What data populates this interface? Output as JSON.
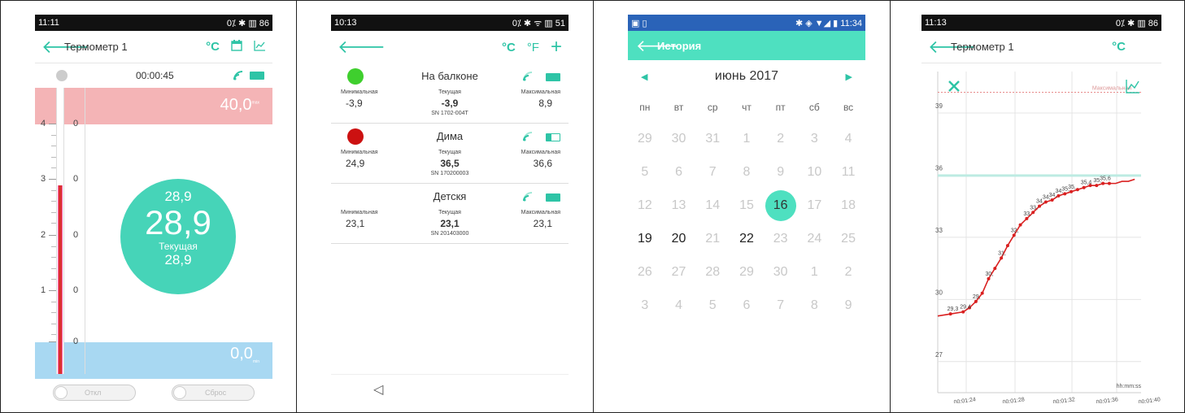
{
  "colors": {
    "accent": "#2ec4a6",
    "hot": "#f4b4b6",
    "cold": "#a8d8f2",
    "mercury": "#d9322e"
  },
  "s1": {
    "status_time": "11:11",
    "status_right": "0⁒ ✱ ▥ 86",
    "title": "Термометр 1",
    "c_icon": "°C",
    "elapsed": "00:00:45",
    "top_value": "40,0",
    "top_unit": "max",
    "bottom_value": "0,0",
    "bottom_unit": "min",
    "scale": [
      {
        "big": "4",
        "small": "0"
      },
      {
        "big": "3",
        "small": "0"
      },
      {
        "big": "2",
        "small": "0"
      },
      {
        "big": "1",
        "small": "0"
      },
      {
        "big": "",
        "small": "0"
      }
    ],
    "circle_top": "28,9",
    "circle_main": "28,9",
    "circle_label": "Текущая",
    "circle_bottom": "28,9",
    "btn_left": "Откл",
    "btn_right": "Сброс"
  },
  "s2": {
    "status_time": "10:13",
    "status_right": "0⁒ ✱ ᯤ ▥ 51",
    "c_label": "°C",
    "f_label": "°F",
    "cards": [
      {
        "name": "На балконе",
        "dot": "#3fcf2e",
        "min_label": "Минимальная",
        "cur_label": "Текущая",
        "max_label": "Максимальная",
        "min": "-3,9",
        "cur": "-3,9",
        "max": "8,9",
        "sn": "SN 1702-004T",
        "battery": 1.0
      },
      {
        "name": "Дима",
        "dot": "#cc1111",
        "min_label": "Минимальная",
        "cur_label": "Текущая",
        "max_label": "Максимальная",
        "min": "24,9",
        "cur": "36,5",
        "max": "36,6",
        "sn": "SN 170200003",
        "battery": 0.35
      },
      {
        "name": "Детскя",
        "dot": "",
        "min_label": "Минимальная",
        "cur_label": "Текущая",
        "max_label": "Максимальная",
        "min": "23,1",
        "cur": "23,1",
        "max": "23,1",
        "sn": "SN 201403000",
        "battery": 1.0
      }
    ]
  },
  "s3": {
    "status_time": "11:34",
    "title": "История",
    "month": "июнь 2017",
    "weekdays": [
      "пн",
      "вт",
      "ср",
      "чт",
      "пт",
      "сб",
      "вс"
    ],
    "weeks": [
      [
        {
          "d": "29",
          "s": "o"
        },
        {
          "d": "30",
          "s": "o"
        },
        {
          "d": "31",
          "s": "o"
        },
        {
          "d": "1",
          "s": "o"
        },
        {
          "d": "2",
          "s": "o"
        },
        {
          "d": "3",
          "s": "o"
        },
        {
          "d": "4",
          "s": "o"
        }
      ],
      [
        {
          "d": "5",
          "s": "o"
        },
        {
          "d": "6",
          "s": "o"
        },
        {
          "d": "7",
          "s": "o"
        },
        {
          "d": "8",
          "s": "o"
        },
        {
          "d": "9",
          "s": "o"
        },
        {
          "d": "10",
          "s": "o"
        },
        {
          "d": "11",
          "s": "o"
        }
      ],
      [
        {
          "d": "12",
          "s": "o"
        },
        {
          "d": "13",
          "s": "o"
        },
        {
          "d": "14",
          "s": "o"
        },
        {
          "d": "15",
          "s": "o"
        },
        {
          "d": "16",
          "s": "sel"
        },
        {
          "d": "17",
          "s": "o"
        },
        {
          "d": "18",
          "s": "o"
        }
      ],
      [
        {
          "d": "19",
          "s": "a"
        },
        {
          "d": "20",
          "s": "a"
        },
        {
          "d": "21",
          "s": "o"
        },
        {
          "d": "22",
          "s": "a"
        },
        {
          "d": "23",
          "s": "o"
        },
        {
          "d": "24",
          "s": "o"
        },
        {
          "d": "25",
          "s": "o"
        }
      ],
      [
        {
          "d": "26",
          "s": "o"
        },
        {
          "d": "27",
          "s": "o"
        },
        {
          "d": "28",
          "s": "o"
        },
        {
          "d": "29",
          "s": "o"
        },
        {
          "d": "30",
          "s": "o"
        },
        {
          "d": "1",
          "s": "o"
        },
        {
          "d": "2",
          "s": "o"
        }
      ],
      [
        {
          "d": "3",
          "s": "o"
        },
        {
          "d": "4",
          "s": "o"
        },
        {
          "d": "5",
          "s": "o"
        },
        {
          "d": "6",
          "s": "o"
        },
        {
          "d": "7",
          "s": "o"
        },
        {
          "d": "8",
          "s": "o"
        },
        {
          "d": "9",
          "s": "o"
        }
      ]
    ]
  },
  "s4": {
    "status_time": "11:13",
    "status_right": "0⁒ ✱ ▥ 86",
    "title": "Термометр 1",
    "c_icon": "°C",
    "chart_data": {
      "type": "line",
      "xlabel": "hh:mm:ss",
      "x_ticks": [
        "00:01:24",
        "00:01:28",
        "00:01:32",
        "00:01:36",
        "00:01:40"
      ],
      "y_ticks": [
        27,
        30,
        33,
        36,
        39
      ],
      "ylim": [
        25.5,
        41
      ],
      "max_line": {
        "label": "Максимальная",
        "value": 40.0
      },
      "current_line": 36.0,
      "series": [
        {
          "x": [
            0,
            2,
            4,
            5,
            6,
            7,
            8,
            9,
            10,
            11,
            12,
            13,
            14,
            15,
            16,
            17,
            18,
            19,
            20,
            21,
            22,
            23,
            24,
            25,
            26,
            27,
            28,
            29,
            30,
            31
          ],
          "y": [
            29.2,
            29.3,
            29.4,
            29.6,
            29.9,
            30.3,
            31.0,
            31.5,
            32.0,
            32.6,
            33.1,
            33.6,
            33.9,
            34.2,
            34.5,
            34.7,
            34.8,
            35.0,
            35.1,
            35.2,
            35.3,
            35.4,
            35.5,
            35.5,
            35.6,
            35.6,
            35.6,
            35.7,
            35.7,
            35.8
          ]
        }
      ],
      "point_labels": [
        {
          "i": 1,
          "t": "29,3"
        },
        {
          "i": 2,
          "t": "29,4"
        },
        {
          "i": 4,
          "t": "29,"
        },
        {
          "i": 6,
          "t": "30,"
        },
        {
          "i": 8,
          "t": "31,"
        },
        {
          "i": 10,
          "t": "32,"
        },
        {
          "i": 12,
          "t": "33,"
        },
        {
          "i": 13,
          "t": "33,"
        },
        {
          "i": 14,
          "t": "34,"
        },
        {
          "i": 15,
          "t": "34,"
        },
        {
          "i": 16,
          "t": "34,"
        },
        {
          "i": 17,
          "t": "34,"
        },
        {
          "i": 18,
          "t": "35,"
        },
        {
          "i": 19,
          "t": "35,"
        },
        {
          "i": 21,
          "t": "35,4"
        },
        {
          "i": 23,
          "t": "35,"
        },
        {
          "i": 24,
          "t": "35,6"
        }
      ]
    }
  }
}
